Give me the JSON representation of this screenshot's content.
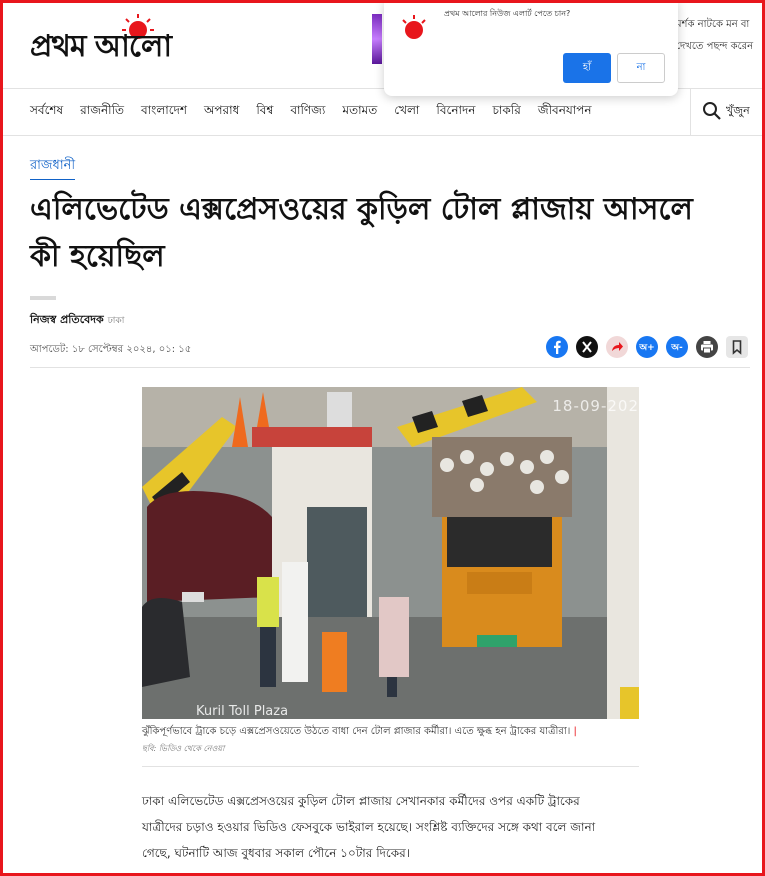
{
  "site": {
    "logo_text": "প্রথম আলো",
    "ticker_line1": "মর্শক নাটকে মন বা",
    "ticker_line2": "দেখতে পছন্দ করেন"
  },
  "popup": {
    "message": "প্রথম আলোর নিউজ এলার্ট পেতে চান?",
    "yes_label": "হাঁ",
    "no_label": "না"
  },
  "nav": {
    "items": [
      "সর্বশেষ",
      "রাজনীতি",
      "বাংলাদেশ",
      "অপরাধ",
      "বিশ্ব",
      "বাণিজ্য",
      "মতামত",
      "খেলা",
      "বিনোদন",
      "চাকরি",
      "জীবনযাপন"
    ],
    "search_label": "খুঁজুন"
  },
  "article": {
    "section": "রাজধানী",
    "headline": "এলিভেটেড এক্সপ্রেসওয়ের কুড়িল টোল প্লাজায় আসলে কী হয়েছিল",
    "author": "নিজস্ব প্রতিবেদক",
    "location": "ঢাকা",
    "updated": "আপডেট: ১৮ সেপ্টেম্বর ২০২৪, ০১: ১৫",
    "photo_date": "18-09-202",
    "photo_place": "Kuril Toll Plaza",
    "caption": "ঝুঁকিপূর্ণভাবে ট্রাকে চড়ে এক্সপ্রেসওয়েতে উঠতে বাধা দেন টোল প্লাজার কর্মীরা। এতে ক্ষুব্ধ হন ট্রাকের যাত্রীরা।",
    "caption_bar": "|",
    "credit": "ছবি: ভিডিও থেকে নেওয়া",
    "body": "ঢাকা এলিভেটেড এক্সপ্রেসওয়ের কুড়িল টোল প্লাজায় সেখানকার কর্মীদের ওপর একটি ট্রাকের যাত্রীদের চড়াও হওয়ার ভিডিও ফেসবুকে ভাইরাল হয়েছে। সংশ্লিষ্ট ব্যক্তিদের সঙ্গে কথা বলে জানা গেছে, ঘটনাটি আজ বুধবার সকাল পৌনে ১০টার দিকের।"
  },
  "share": {
    "icons": [
      "facebook-icon",
      "x-icon",
      "forward-icon",
      "font-increase-icon",
      "font-decrease-icon",
      "print-icon",
      "bookmark-icon"
    ],
    "a_plus": "অ+",
    "a_minus": "অ-",
    "colors": {
      "facebook": "#1877f2",
      "x": "#111111",
      "forward": "#e8161c",
      "font": "#1877f2",
      "print": "#444444",
      "bookmark": "#cfcfcf"
    }
  },
  "colors": {
    "brand_red": "#e8161c",
    "link_blue": "#1162c7"
  }
}
